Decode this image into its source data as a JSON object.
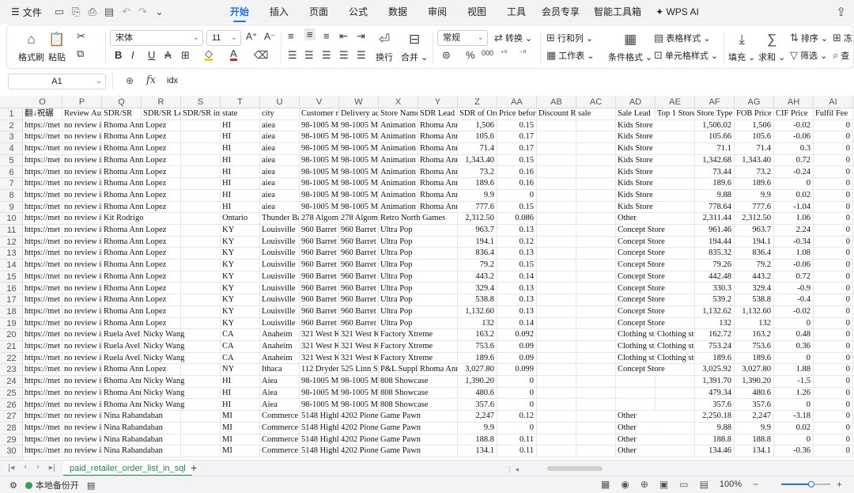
{
  "menubar": {
    "file_label": "文件",
    "tabs": [
      "开始",
      "插入",
      "页面",
      "公式",
      "数据",
      "审阅",
      "视图",
      "工具",
      "会员专享",
      "智能工具箱",
      "WPS AI"
    ],
    "active_tab": "开始"
  },
  "ribbon": {
    "format_painter": "格式刷",
    "paste": "粘贴",
    "font_name": "宋体",
    "font_size": "11",
    "number_format": "常规",
    "convert": "转换",
    "wrap": "换行",
    "merge": "合并",
    "rows_cols": "行和列",
    "worksheet": "工作表",
    "cond_format": "条件格式",
    "table_style": "表格样式",
    "cell_style": "单元格样式",
    "fill": "填充",
    "sum": "求和",
    "sort": "排序",
    "filter": "筛选",
    "freeze": "冻",
    "find": "查"
  },
  "formula_bar": {
    "cell_ref": "A1",
    "fx": "fx",
    "content": "idx"
  },
  "grid": {
    "columns": [
      "O",
      "P",
      "Q",
      "R",
      "S",
      "T",
      "U",
      "V",
      "W",
      "X",
      "Y",
      "Z",
      "AA",
      "AB",
      "AC",
      "AD",
      "AE",
      "AF",
      "AG",
      "AH",
      "AI"
    ],
    "header_row": [
      "翻↓祝碾",
      "Review Auc",
      "SDR/SR",
      "SDR/SR Le",
      "SDR/SR in",
      "state",
      "city",
      "Customer re",
      "Delivery ad",
      "Store Name",
      "SDR Lead c",
      "SDR of Ord",
      "Price before",
      "Discount Re",
      "sale",
      "Sale Lead",
      "Top 1 Store",
      "Store Type i",
      "FOB Price",
      "CIF Price",
      "Fulfil Fee"
    ],
    "rows": [
      [
        "https://met",
        "no review in",
        "Rhoma Ann Lopez",
        "",
        "",
        "HI",
        "aiea",
        "98-1005 Mo",
        "98-1005 Mo",
        "Animation",
        "Rhoma Ann",
        "1,506",
        "0.15",
        "",
        "",
        "Kids Store",
        "",
        "1,506.02",
        "1,506",
        "-0.02",
        "0"
      ],
      [
        "https://met",
        "no review in",
        "Rhoma Ann Lopez",
        "",
        "",
        "HI",
        "aiea",
        "98-1005 Mo",
        "98-1005 Mo",
        "Animation",
        "Rhoma Ann",
        "105.6",
        "0.17",
        "",
        "",
        "Kids Store",
        "",
        "105.66",
        "105.6",
        "-0.06",
        "0"
      ],
      [
        "https://met",
        "no review in",
        "Rhoma Ann Lopez",
        "",
        "",
        "HI",
        "aiea",
        "98-1005 Mo",
        "98-1005 Mo",
        "Animation",
        "Rhoma Ann",
        "71.4",
        "0.17",
        "",
        "",
        "Kids Store",
        "",
        "71.1",
        "71.4",
        "0.3",
        "0"
      ],
      [
        "https://met",
        "no review in",
        "Rhoma Ann Lopez",
        "",
        "",
        "HI",
        "aiea",
        "98-1005 Mo",
        "98-1005 Mo",
        "Animation",
        "Rhoma Ann",
        "1,343.40",
        "0.15",
        "",
        "",
        "Kids Store",
        "",
        "1,342.68",
        "1,343.40",
        "0.72",
        "0"
      ],
      [
        "https://met",
        "no review in",
        "Rhoma Ann Lopez",
        "",
        "",
        "HI",
        "aiea",
        "98-1005 Mo",
        "98-1005 Mo",
        "Animation",
        "Rhoma Ann",
        "73.2",
        "0.16",
        "",
        "",
        "Kids Store",
        "",
        "73.44",
        "73.2",
        "-0.24",
        "0"
      ],
      [
        "https://met",
        "no review in",
        "Rhoma Ann Lopez",
        "",
        "",
        "HI",
        "aiea",
        "98-1005 Mo",
        "98-1005 Mo",
        "Animation",
        "Rhoma Ann",
        "189.6",
        "0.16",
        "",
        "",
        "Kids Store",
        "",
        "189.6",
        "189.6",
        "0",
        "0"
      ],
      [
        "https://met",
        "no review in",
        "Rhoma Ann Lopez",
        "",
        "",
        "HI",
        "aiea",
        "98-1005 Mo",
        "98-1005 Mo",
        "Animation",
        "Rhoma Ann",
        "9.9",
        "0",
        "",
        "",
        "Kids Store",
        "",
        "9.88",
        "9.9",
        "0.02",
        "0"
      ],
      [
        "https://met",
        "no review in",
        "Rhoma Ann Lopez",
        "",
        "",
        "HI",
        "aiea",
        "98-1005 Mo",
        "98-1005 Mo",
        "Animation",
        "Rhoma Ann",
        "777.6",
        "0.15",
        "",
        "",
        "Kids Store",
        "",
        "778.64",
        "777.6",
        "-1.04",
        "0"
      ],
      [
        "https://met",
        "no review in",
        "Kit Rodrigo",
        "",
        "",
        "Ontario",
        "Thunder Ba",
        "278 Algoma",
        "278 Algoma",
        "Retro North Games",
        "",
        "2,312.50",
        "0.086",
        "",
        "",
        "Other",
        "",
        "2,311.44",
        "2,312.50",
        "1.06",
        "0"
      ],
      [
        "https://met",
        "no review in",
        "Rhoma Ann Lopez",
        "",
        "",
        "KY",
        "Louisville",
        "960 Barret A",
        "960 Barret A",
        "Ultra Pop",
        "",
        "963.7",
        "0.13",
        "",
        "",
        "Concept Store",
        "",
        "961.46",
        "963.7",
        "2.24",
        "0"
      ],
      [
        "https://met",
        "no review in",
        "Rhoma Ann Lopez",
        "",
        "",
        "KY",
        "Louisville",
        "960 Barret A",
        "960 Barret A",
        "Ultra Pop",
        "",
        "194.1",
        "0.12",
        "",
        "",
        "Concept Store",
        "",
        "194.44",
        "194.1",
        "-0.34",
        "0"
      ],
      [
        "https://met",
        "no review in",
        "Rhoma Ann Lopez",
        "",
        "",
        "KY",
        "Louisville",
        "960 Barret A",
        "960 Barret A",
        "Ultra Pop",
        "",
        "836.4",
        "0.13",
        "",
        "",
        "Concept Store",
        "",
        "835.32",
        "836.4",
        "1.08",
        "0"
      ],
      [
        "https://met",
        "no review in",
        "Rhoma Ann Lopez",
        "",
        "",
        "KY",
        "Louisville",
        "960 Barret A",
        "960 Barret A",
        "Ultra Pop",
        "",
        "79.2",
        "0.15",
        "",
        "",
        "Concept Store",
        "",
        "79.26",
        "79.2",
        "-0.06",
        "0"
      ],
      [
        "https://met",
        "no review in",
        "Rhoma Ann Lopez",
        "",
        "",
        "KY",
        "Louisville",
        "960 Barret A",
        "960 Barret A",
        "Ultra Pop",
        "",
        "443.2",
        "0.14",
        "",
        "",
        "Concept Store",
        "",
        "442.48",
        "443.2",
        "0.72",
        "0"
      ],
      [
        "https://met",
        "no review in",
        "Rhoma Ann Lopez",
        "",
        "",
        "KY",
        "Louisville",
        "960 Barret A",
        "960 Barret A",
        "Ultra Pop",
        "",
        "329.4",
        "0.13",
        "",
        "",
        "Concept Store",
        "",
        "330.3",
        "329.4",
        "-0.9",
        "0"
      ],
      [
        "https://met",
        "no review in",
        "Rhoma Ann Lopez",
        "",
        "",
        "KY",
        "Louisville",
        "960 Barret A",
        "960 Barret A",
        "Ultra Pop",
        "",
        "538.8",
        "0.13",
        "",
        "",
        "Concept Store",
        "",
        "539.2",
        "538.8",
        "-0.4",
        "0"
      ],
      [
        "https://met",
        "no review in",
        "Rhoma Ann Lopez",
        "",
        "",
        "KY",
        "Louisville",
        "960 Barret A",
        "960 Barret A",
        "Ultra Pop",
        "",
        "1,132.60",
        "0.13",
        "",
        "",
        "Concept Store",
        "",
        "1,132.62",
        "1,132.60",
        "-0.02",
        "0"
      ],
      [
        "https://met",
        "no review in",
        "Rhoma Ann Lopez",
        "",
        "",
        "KY",
        "Louisville",
        "960 Barret A",
        "960 Barret A",
        "Ultra Pop",
        "",
        "132",
        "0.14",
        "",
        "",
        "Concept Store",
        "",
        "132",
        "132",
        "0",
        "0"
      ],
      [
        "https://met",
        "no review in",
        "Ruela Aveli",
        "Nicky Wang",
        "",
        "CA",
        "Anaheim",
        "321 West Ka",
        "321 West Ka",
        "Factory Xtreme",
        "",
        "163.2",
        "0.092",
        "",
        "",
        "Clothing sto",
        "Clothing sto",
        "162.72",
        "163.2",
        "0.48",
        "0"
      ],
      [
        "https://met",
        "no review in",
        "Ruela Aveli",
        "Nicky Wang",
        "",
        "CA",
        "Anaheim",
        "321 West Ka",
        "321 West Ka",
        "Factory Xtreme",
        "",
        "753.6",
        "0.09",
        "",
        "",
        "Clothing sto",
        "Clothing sto",
        "753.24",
        "753.6",
        "0.36",
        "0"
      ],
      [
        "https://met",
        "no review in",
        "Ruela Aveli",
        "Nicky Wang",
        "",
        "CA",
        "Anaheim",
        "321 West Ka",
        "321 West Ka",
        "Factory Xtreme",
        "",
        "189.6",
        "0.09",
        "",
        "",
        "Clothing sto",
        "Clothing sto",
        "189.6",
        "189.6",
        "0",
        "0"
      ],
      [
        "https://met",
        "no review in",
        "Rhoma Ann Lopez",
        "",
        "",
        "NY",
        "Ithaca",
        "112 Dryden",
        "525 Linn St",
        "P&L Supply",
        "Rhoma Ann",
        "3,027.80",
        "0.099",
        "",
        "",
        "Concept Store",
        "",
        "3,025.92",
        "3,027.80",
        "1.88",
        "0"
      ],
      [
        "https://met",
        "no review in",
        "Rhoma Ann",
        "Nicky Wang",
        "",
        "HI",
        "Aiea",
        "98-1005 Mo",
        "98-1005 Mo",
        "808 Showcase",
        "",
        "1,390.20",
        "0",
        "",
        "",
        "",
        "",
        "1,391.70",
        "1,390.20",
        "-1.5",
        "0"
      ],
      [
        "https://met",
        "no review in",
        "Rhoma Ann",
        "Nicky Wang",
        "",
        "HI",
        "Aiea",
        "98-1005 Mo",
        "98-1005 Mo",
        "808 Showcase",
        "",
        "480.6",
        "0",
        "",
        "",
        "",
        "",
        "479.34",
        "480.6",
        "1.26",
        "0"
      ],
      [
        "https://met",
        "no review in",
        "Rhoma Ann",
        "Nicky Wang",
        "",
        "HI",
        "Aiea",
        "98-1005 Mo",
        "98-1005 Mo",
        "808 Showcase",
        "",
        "357.6",
        "0",
        "",
        "",
        "",
        "",
        "357.6",
        "357.6",
        "0",
        "0"
      ],
      [
        "https://met",
        "no review in",
        "Nina Rabandaban",
        "",
        "",
        "MI",
        "Commerce",
        "5148 Highla",
        "4202 Pionee",
        "Game Pawn",
        "",
        "2,247",
        "0.12",
        "",
        "",
        "Other",
        "",
        "2,250.18",
        "2,247",
        "-3.18",
        "0"
      ],
      [
        "https://met",
        "no review in",
        "Nina Rabandaban",
        "",
        "",
        "MI",
        "Commerce",
        "5148 Highla",
        "4202 Pionee",
        "Game Pawn",
        "",
        "9.9",
        "0",
        "",
        "",
        "Other",
        "",
        "9.88",
        "9.9",
        "0.02",
        "0"
      ],
      [
        "https://met",
        "no review in",
        "Nina Rabandaban",
        "",
        "",
        "MI",
        "Commerce",
        "5148 Highla",
        "4202 Pionee",
        "Game Pawn",
        "",
        "188.8",
        "0.11",
        "",
        "",
        "Other",
        "",
        "188.8",
        "188.8",
        "0",
        "0"
      ],
      [
        "https://met",
        "no review in",
        "Nina Rabandaban",
        "",
        "",
        "MI",
        "Commerce",
        "5148 Highla",
        "4202 Pionee",
        "Game Pawn",
        "",
        "134.1",
        "0.11",
        "",
        "",
        "Other",
        "",
        "134.46",
        "134.1",
        "-0.36",
        "0"
      ]
    ]
  },
  "sheet_tabs": {
    "active_sheet": "paid_retailer_order_list_in_sql"
  },
  "status_bar": {
    "backup": "本地备份开",
    "zoom": "100%",
    "zoom_level": 0.62
  }
}
